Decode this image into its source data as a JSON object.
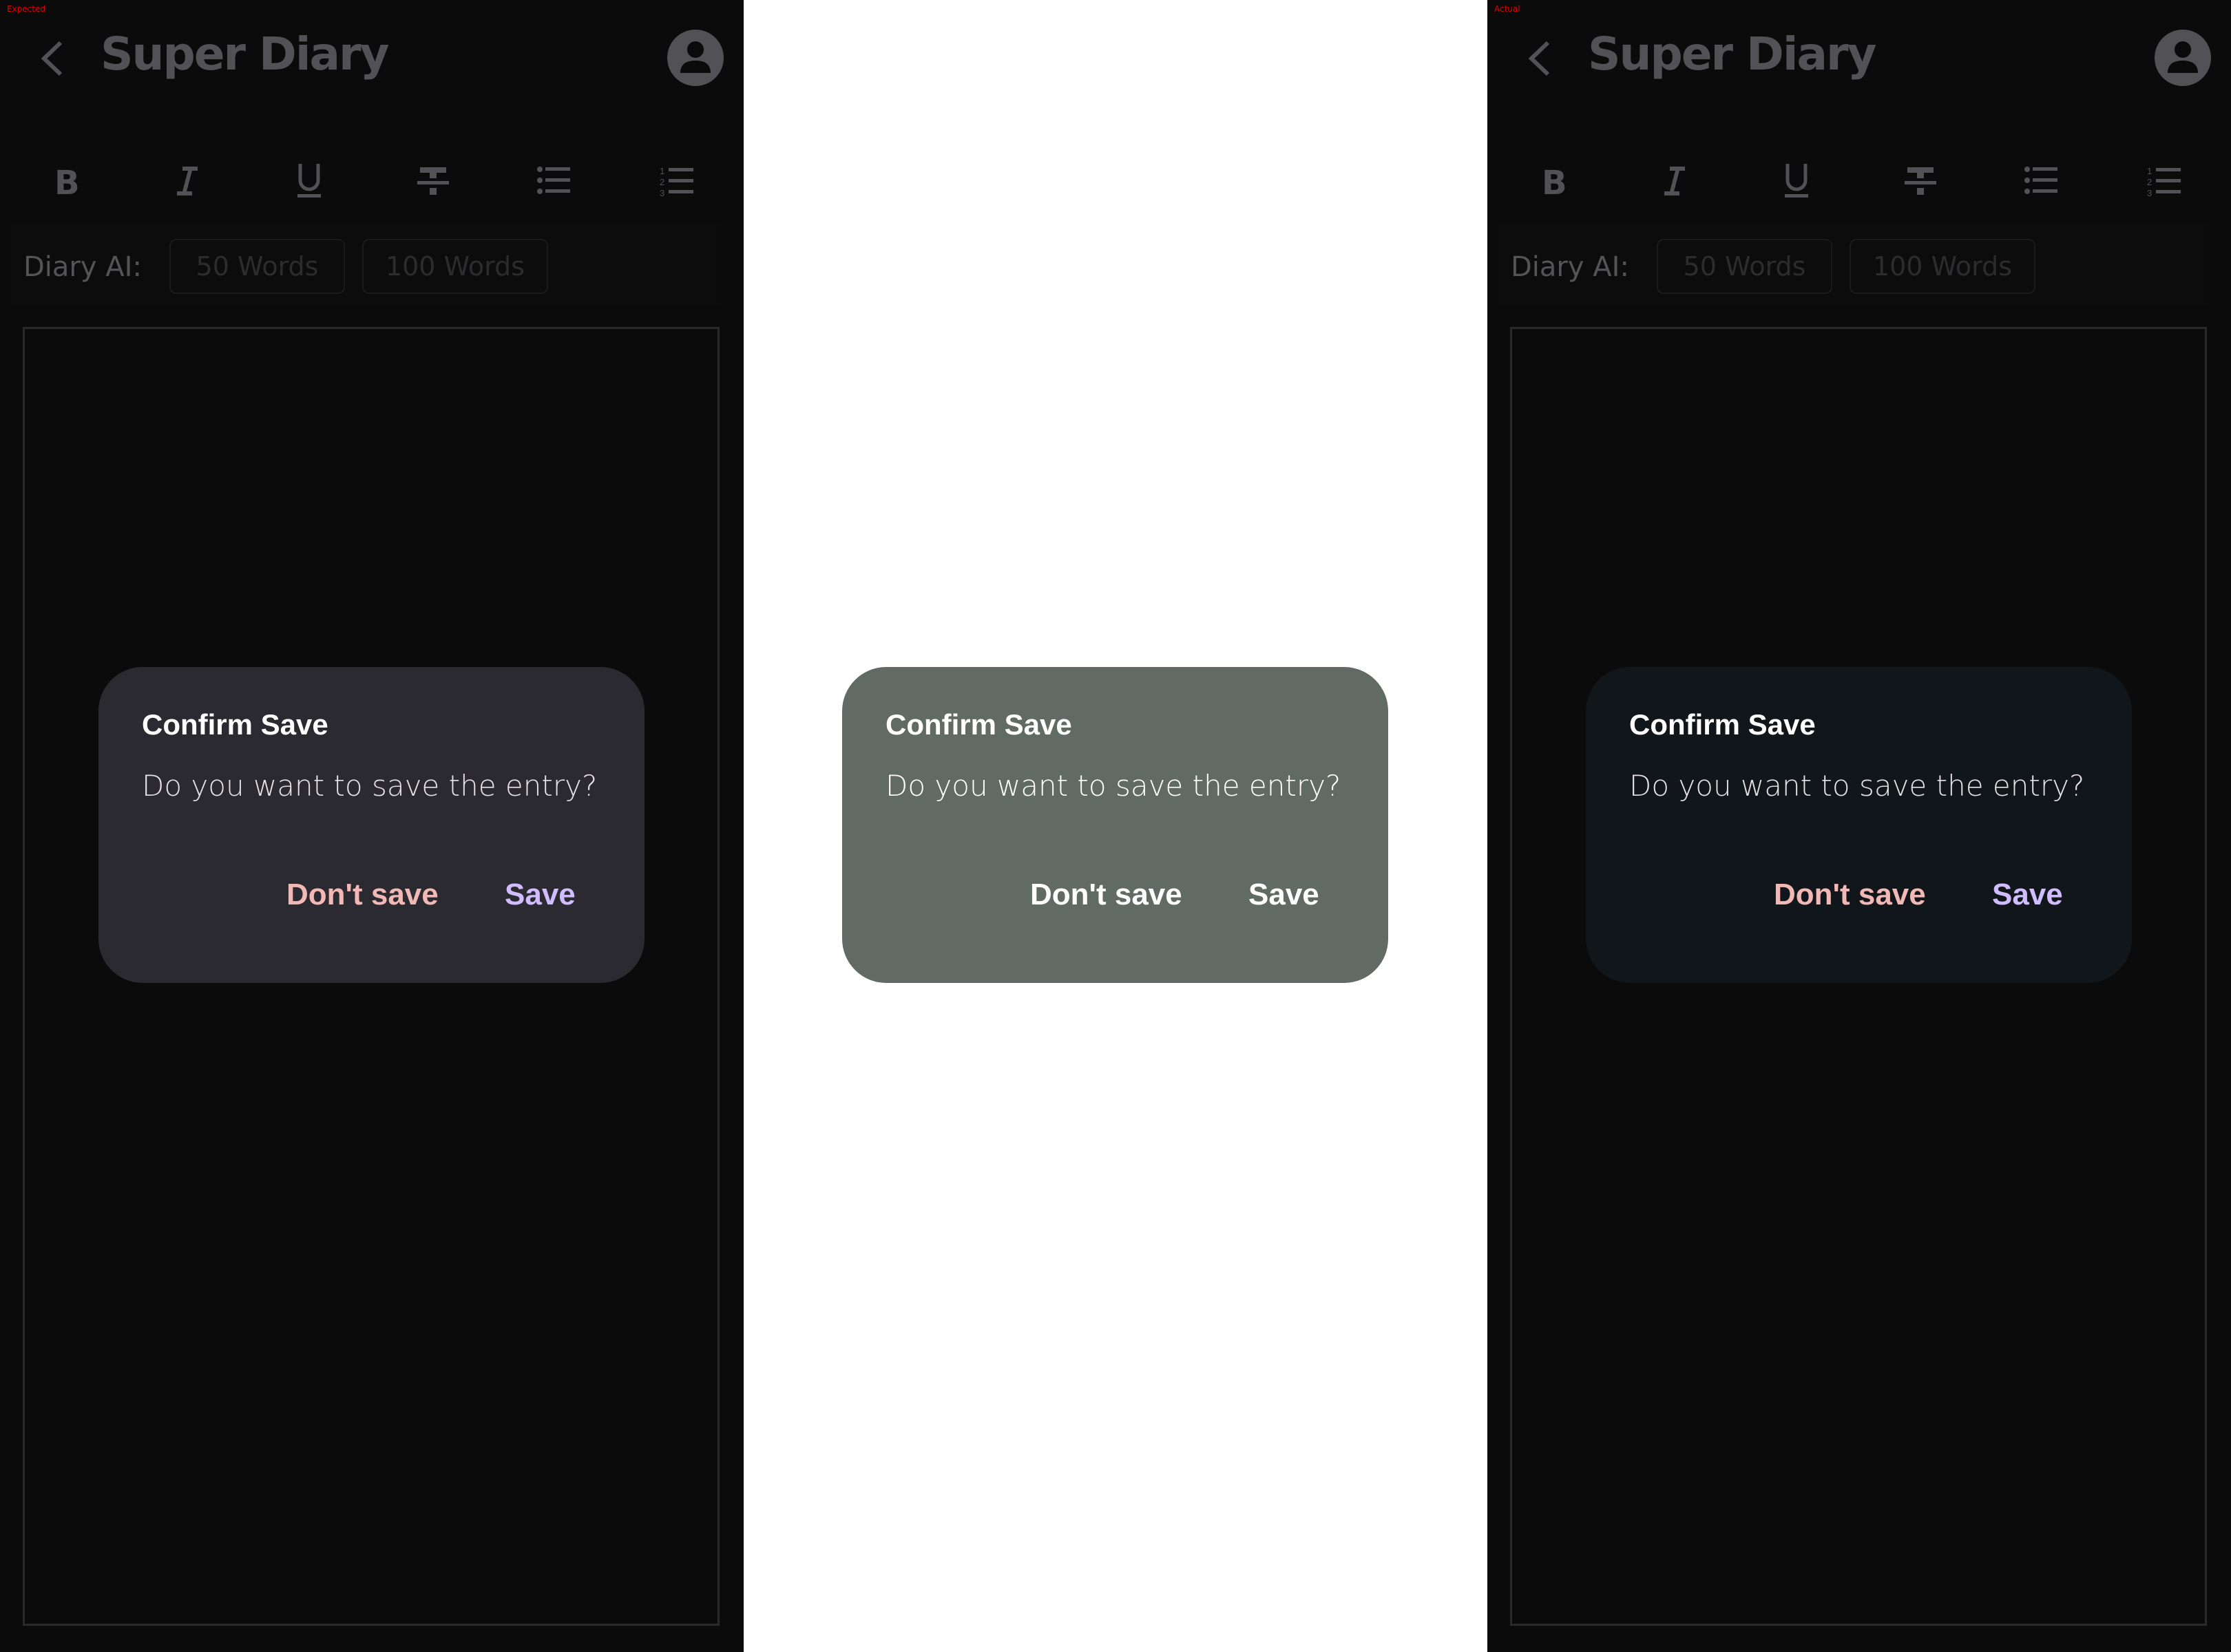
{
  "panels": [
    {
      "tag": "Expected",
      "app_title": "Super Diary",
      "toolbar": [
        "bold",
        "italic",
        "underline",
        "strikethrough",
        "bulleted-list",
        "numbered-list"
      ],
      "ai": {
        "label": "Diary AI:",
        "btn50": "50 Words",
        "btn100": "100 Words"
      },
      "dialog": {
        "title": "Confirm Save",
        "message": "Do you want to save the entry?",
        "dont_save": "Don't save",
        "save": "Save",
        "bg": "#2b2a30",
        "dont_color": "#f2b8b5",
        "save_color": "#d0bcff"
      }
    },
    {
      "dialog": {
        "title": "Confirm Save",
        "message": "Do you want to save the entry?",
        "dont_save": "Don't save",
        "save": "Save",
        "bg": "#626a65",
        "dont_color": "#ffffff",
        "save_color": "#ffffff"
      }
    },
    {
      "tag": "Actual",
      "app_title": "Super Diary",
      "toolbar": [
        "bold",
        "italic",
        "underline",
        "strikethrough",
        "bulleted-list",
        "numbered-list"
      ],
      "ai": {
        "label": "Diary AI:",
        "btn50": "50 Words",
        "btn100": "100 Words"
      },
      "dialog": {
        "title": "Confirm Save",
        "message": "Do you want to save the entry?",
        "dont_save": "Don't save",
        "save": "Save",
        "bg": "#11161a",
        "dont_color": "#f2b8b5",
        "save_color": "#d0bcff"
      }
    }
  ],
  "colors": {
    "icon": "#525155",
    "background": "#0b0b0b"
  }
}
